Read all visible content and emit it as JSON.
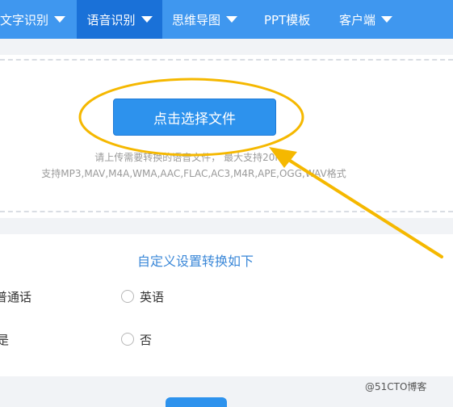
{
  "nav": {
    "items": [
      {
        "label": "文字识别",
        "caret": true
      },
      {
        "label": "语音识别",
        "caret": true,
        "active": true
      },
      {
        "label": "思维导图",
        "caret": true
      },
      {
        "label": "PPT模板",
        "caret": false
      },
      {
        "label": "客户端",
        "caret": true
      }
    ]
  },
  "upload": {
    "button_label": "点击选择文件",
    "hint_line1": "请上传需要转换的语音文件，   最大支持20M，",
    "hint_line2": "支持MP3,MAV,M4A,WMA,AAC,FLAC,AC3,M4R,APE,OGG,WAV格式"
  },
  "settings": {
    "title": "自定义设置转换如下",
    "row1": {
      "left_label": "普通话",
      "right_label": "英语"
    },
    "row2": {
      "left_label": "是",
      "right_label": "否"
    }
  },
  "watermark": "@51CTO博客",
  "colors": {
    "nav_bg": "#3f97ef",
    "nav_active": "#1a71d8",
    "button": "#2d92ed",
    "annotation": "#f5b800",
    "title": "#3b88d8"
  },
  "icons": [
    "chevron-down-icon",
    "radio-icon",
    "annotation-ellipse",
    "annotation-arrow"
  ]
}
